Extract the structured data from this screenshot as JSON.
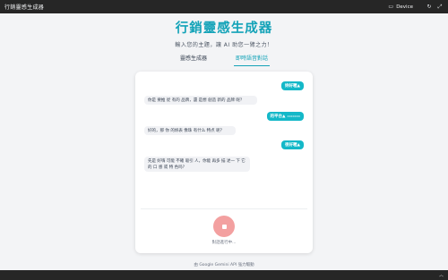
{
  "window": {
    "title": "行銷靈感生成器",
    "device_label": "Device",
    "icons": [
      "device-icon",
      "refresh-icon",
      "expand-icon",
      "chevron-up-icon"
    ]
  },
  "header": {
    "title": "行銷靈感生成器",
    "subtitle": "輸入您的主題，讓 AI 助您一臂之力！"
  },
  "tabs": [
    {
      "label": "靈感生成器",
      "active": false
    },
    {
      "label": "即時語音對話",
      "active": true
    }
  ],
  "chat": {
    "messages": [
      {
        "role": "user",
        "text": "妳好喔▲"
      },
      {
        "role": "ai",
        "text": "你是 要推 從 有的 品牌，還 是想 創造 新的 品牌 呢？"
      },
      {
        "role": "user",
        "text": "的平台▲",
        "sub": "xxxxxxx"
      },
      {
        "role": "ai",
        "text": "好的，那 你 的妳表 像珠 有什么 特点 呢？"
      },
      {
        "role": "user",
        "text": "很好喔▲"
      },
      {
        "role": "ai",
        "text": "先是 好嗨 可能 不確 吸引 人，你能 再多 描 述一 下 它的 口 感 或 特 色吗？"
      }
    ]
  },
  "controls": {
    "status": "對話進行中...",
    "record_icon": "stop-icon"
  },
  "footer": {
    "text": "由 Google Gemini API 強力驅動"
  },
  "colors": {
    "accent": "#14a3b8",
    "user_bubble": "#14b8c8",
    "mic_button": "#f3a0a0",
    "chrome": "#262626"
  }
}
